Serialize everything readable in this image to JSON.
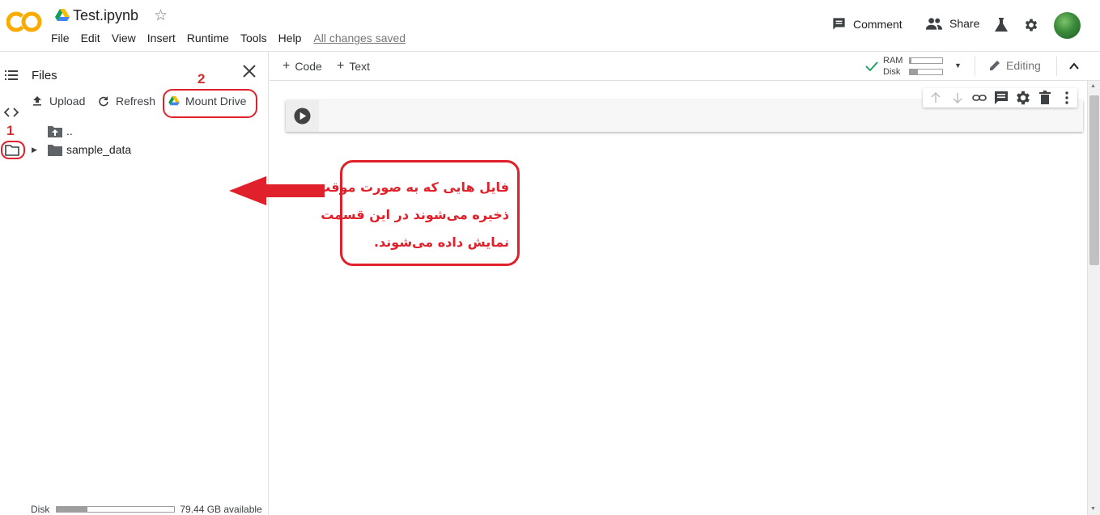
{
  "header": {
    "logo_text": "CO",
    "notebook_title": "Test.ipynb",
    "menu": [
      "File",
      "Edit",
      "View",
      "Insert",
      "Runtime",
      "Tools",
      "Help"
    ],
    "save_status": "All changes saved",
    "comment_label": "Comment",
    "share_label": "Share"
  },
  "files_panel": {
    "title": "Files",
    "upload_label": "Upload",
    "refresh_label": "Refresh",
    "mount_drive_label": "Mount Drive",
    "tree": [
      {
        "label": ".."
      },
      {
        "label": "sample_data"
      }
    ],
    "disk_label": "Disk",
    "disk_available": "79.44 GB available",
    "disk_used_fraction": 0.26
  },
  "toolbar": {
    "code_label": "Code",
    "text_label": "Text",
    "ram_label": "RAM",
    "disk_label": "Disk",
    "ram_used_fraction": 0.05,
    "disk_used_fraction": 0.25,
    "editing_label": "Editing"
  },
  "annotations": {
    "label_1": "1",
    "label_2": "2",
    "callout_lines": [
      "فایل هایی که به صورت موقت",
      "ذخیره می‌شوند در این قسمت",
      "نمایش داده می‌شوند."
    ]
  },
  "colors": {
    "annotation_red": "#e0202a",
    "colab_orange": "#f9ab00",
    "check_green": "#0f9d58"
  }
}
